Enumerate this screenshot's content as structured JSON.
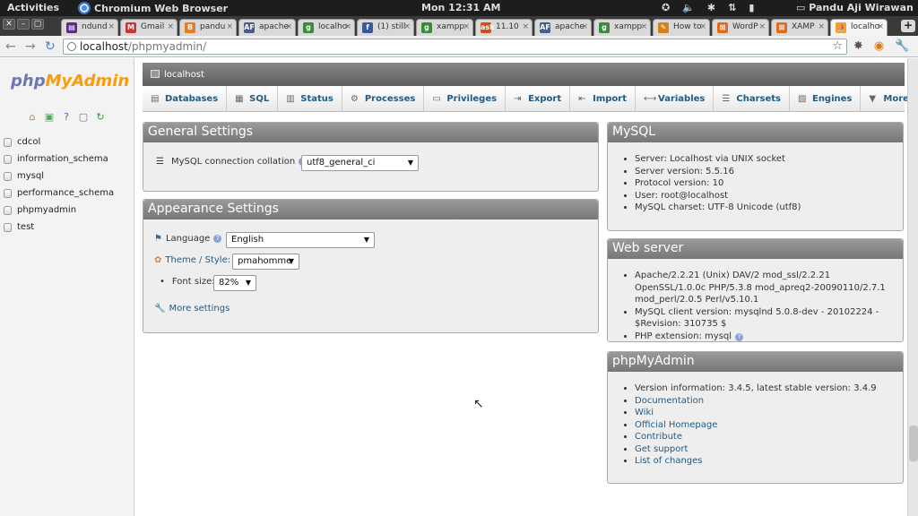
{
  "topbar": {
    "activities": "Activities",
    "app": "Chromium Web Browser",
    "clock": "Mon 12:31 AM",
    "user": "Pandu Aji Wirawan",
    "tray_icons": [
      "accessibility-icon",
      "volume-icon",
      "bluetooth-icon",
      "network-icon",
      "battery-icon"
    ]
  },
  "tabs": [
    {
      "label": "ndund",
      "fav": "#5b2b8f",
      "glyph": "▤"
    },
    {
      "label": "Gmail",
      "fav": "#c33",
      "glyph": "M"
    },
    {
      "label": "pandu",
      "fav": "#e87c1e",
      "glyph": "B"
    },
    {
      "label": "apache",
      "fav": "#4a5d8a",
      "glyph": "AF"
    },
    {
      "label": "localho",
      "fav": "#3a8a3a",
      "glyph": "g"
    },
    {
      "label": "(1) still",
      "fav": "#3b5998",
      "glyph": "f"
    },
    {
      "label": "xampp",
      "fav": "#3a8a3a",
      "glyph": "g"
    },
    {
      "label": "11.10",
      "fav": "#d24d1b",
      "glyph": "ask"
    },
    {
      "label": "apache",
      "fav": "#4a5d8a",
      "glyph": "AF"
    },
    {
      "label": "xampp",
      "fav": "#3a8a3a",
      "glyph": "g"
    },
    {
      "label": "How to",
      "fav": "#d7801a",
      "glyph": "✎"
    },
    {
      "label": "WordP",
      "fav": "#e0691b",
      "glyph": "⊠"
    },
    {
      "label": "XAMP",
      "fav": "#e0691b",
      "glyph": "⊠"
    },
    {
      "label": "localho",
      "fav": "#f0a030",
      "glyph": "⛵"
    }
  ],
  "address": {
    "host": "localhost",
    "path": "/phpmyadmin/"
  },
  "sidebar": {
    "logo_php": "php",
    "logo_my": "My",
    "logo_admin": "Admin",
    "databases": [
      "cdcol",
      "information_schema",
      "mysql",
      "performance_schema",
      "phpmyadmin",
      "test"
    ]
  },
  "breadcrumb": "localhost",
  "menu": [
    {
      "label": "Databases",
      "icon": "▤"
    },
    {
      "label": "SQL",
      "icon": "▦"
    },
    {
      "label": "Status",
      "icon": "▥"
    },
    {
      "label": "Processes",
      "icon": "⚙"
    },
    {
      "label": "Privileges",
      "icon": "▭"
    },
    {
      "label": "Export",
      "icon": "⇥"
    },
    {
      "label": "Import",
      "icon": "⇤"
    },
    {
      "label": "Variables",
      "icon": "⟷"
    },
    {
      "label": "Charsets",
      "icon": "☰"
    },
    {
      "label": "Engines",
      "icon": "▧"
    },
    {
      "label": "More",
      "icon": "▼"
    }
  ],
  "general": {
    "title": "General Settings",
    "collation_label": "MySQL connection collation",
    "collation_value": "utf8_general_ci"
  },
  "appearance": {
    "title": "Appearance Settings",
    "language_label": "Language",
    "language_value": "English",
    "theme_label": "Theme / Style:",
    "theme_value": "pmahomme",
    "font_label": "Font size:",
    "font_value": "82%",
    "more_settings": "More settings"
  },
  "mysql": {
    "title": "MySQL",
    "items": [
      "Server: Localhost via UNIX socket",
      "Server version: 5.5.16",
      "Protocol version: 10",
      "User: root@localhost",
      "MySQL charset: UTF-8 Unicode (utf8)"
    ]
  },
  "webserver": {
    "title": "Web server",
    "items": [
      "Apache/2.2.21 (Unix) DAV/2 mod_ssl/2.2.21 OpenSSL/1.0.0c PHP/5.3.8 mod_apreq2-20090110/2.7.1 mod_perl/2.0.5 Perl/v5.10.1",
      "MySQL client version: mysqlnd 5.0.8-dev - 20102224 - $Revision: 310735 $",
      "PHP extension: mysql"
    ]
  },
  "pma": {
    "title": "phpMyAdmin",
    "version": "Version information: 3.4.5, latest stable version: 3.4.9",
    "links": [
      "Documentation",
      "Wiki",
      "Official Homepage",
      "Contribute",
      "Get support",
      "List of changes"
    ]
  }
}
